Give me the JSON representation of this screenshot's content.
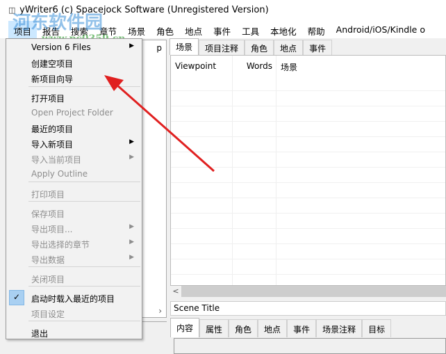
{
  "window": {
    "title": "yWriter6 (c) Spacejock Software (Unregistered Version)"
  },
  "menubar": [
    "项目",
    "报告",
    "搜索",
    "章节",
    "场景",
    "角色",
    "地点",
    "事件",
    "工具",
    "本地化",
    "帮助",
    "Android/iOS/Kindle o"
  ],
  "left_panel": {
    "label": "p",
    "scroll_arrow": "›"
  },
  "right_tabs": [
    "场景",
    "项目注释",
    "角色",
    "地点",
    "事件"
  ],
  "list_headers": [
    "Viewpoint",
    "Words",
    "场景"
  ],
  "scene_title": "Scene Title",
  "bottom_tabs": [
    "内容",
    "属性",
    "角色",
    "地点",
    "事件",
    "场景注释",
    "目标"
  ],
  "menu": {
    "items": [
      {
        "label": "Version 6 Files",
        "disabled": false,
        "submenu": true
      },
      {
        "label": "创建空项目",
        "disabled": false
      },
      {
        "label": "新项目向导",
        "disabled": false
      },
      {
        "label": "打开项目",
        "disabled": false
      },
      {
        "label": "Open Project Folder",
        "disabled": true
      },
      {
        "label": "最近的项目",
        "disabled": false
      },
      {
        "label": "导入新项目",
        "disabled": false,
        "submenu": true
      },
      {
        "label": "导入当前项目",
        "disabled": true,
        "submenu": true
      },
      {
        "label": "Apply Outline",
        "disabled": true
      },
      {
        "label": "打印项目",
        "disabled": true
      },
      {
        "label": "保存项目",
        "disabled": true
      },
      {
        "label": "导出项目...",
        "disabled": true,
        "submenu": true
      },
      {
        "label": "导出选择的章节",
        "disabled": true,
        "submenu": true
      },
      {
        "label": "导出数据",
        "disabled": true,
        "submenu": true
      },
      {
        "label": "关闭项目",
        "disabled": true
      },
      {
        "label": "启动时载入最近的项目",
        "disabled": false,
        "checked": true
      },
      {
        "label": "项目设定",
        "disabled": true
      },
      {
        "label": "退出",
        "disabled": false
      }
    ]
  },
  "watermark": {
    "name": "河东软件园",
    "url": "www.pc0359.cn"
  },
  "colors": {
    "arrow": "#e02020",
    "menu_highlight": "#cce8ff"
  }
}
